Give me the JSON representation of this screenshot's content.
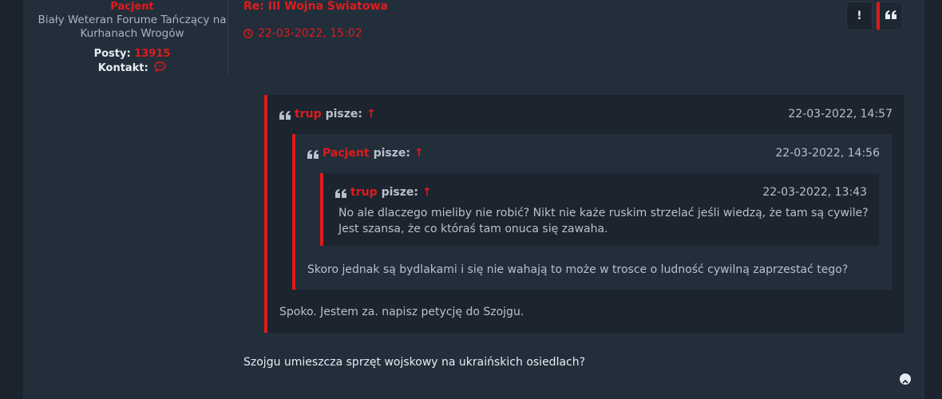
{
  "profile": {
    "username": "Pacjent",
    "rank": "Biały Weteran Forume Tańczący na Kurhanach Wrogów",
    "posts_label": "Posty:",
    "posts_count": "13915",
    "contact_label": "Kontakt:"
  },
  "post": {
    "title": "Re: III Wojna Światowa",
    "date": "22-03-2022, 15:02",
    "report_label": "!",
    "body": "Szojgu umieszcza sprzęt wojskowy na ukraińskich osiedlach?"
  },
  "quotes": {
    "outer": {
      "author": "trup",
      "writes": "pisze:",
      "arrow": "↑",
      "date": "22-03-2022, 14:57",
      "text": "Spoko. Jestem za. napisz petycję do Szojgu."
    },
    "middle": {
      "author": "Pacjent",
      "writes": "pisze:",
      "arrow": "↑",
      "date": "22-03-2022, 14:56",
      "text": "Skoro jednak są bydlakami i się nie wahają to może w trosce o ludność cywilną zaprzestać tego?"
    },
    "inner": {
      "author": "trup",
      "writes": "pisze:",
      "arrow": "↑",
      "date": "22-03-2022, 13:43",
      "text_line1": "No ale dlaczego mieliby nie robić? Nikt nie każe ruskim strzelać jeśli wiedzą, że tam są cywile?",
      "text_line2": "Jest szansa, że co któraś tam onuca się zawaha."
    }
  },
  "colors": {
    "accent": "#e01b1b",
    "background": "#1c2530",
    "panel": "#232e3b",
    "quote_bg": "#1c252f",
    "text": "#b7c0cc"
  },
  "icons": {
    "contact": "chat-bubble-icon",
    "date": "clock-icon",
    "report": "exclamation-icon",
    "quote": "quote-icon",
    "top": "chevron-up-icon"
  }
}
